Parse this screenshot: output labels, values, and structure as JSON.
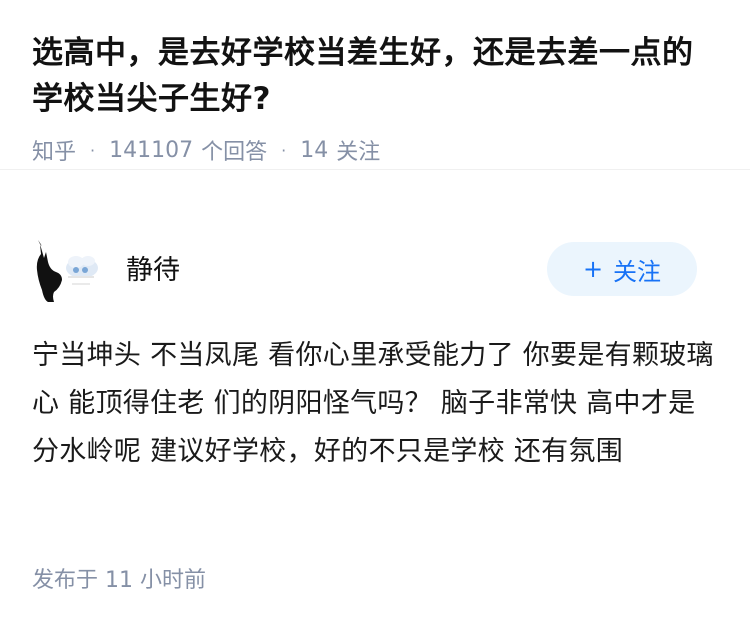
{
  "question": {
    "title": "选高中，是去好学校当差生好，还是去差一点的学校当尖子生好?",
    "source": "知乎",
    "answer_count": "141107",
    "answer_suffix": "个回答",
    "follower_count": "14",
    "follower_suffix": "关注",
    "separator": "·"
  },
  "author": {
    "name": "静待",
    "avatar_icon": "black-cat-avatar-icon",
    "follow_label": "关注",
    "follow_plus": "+"
  },
  "answer": {
    "text": "宁当坤头 不当凤尾 看你心里承受能力了 你要是有颗玻璃心 能顶得住老 们的阴阳怪气吗？ 脑子非常快 高中才是分水岭呢 建议好学校，好的不只是学校 还有氛围",
    "published": "发布于 11 小时前"
  },
  "colors": {
    "accent": "#1772f6",
    "button_bg": "#ebf5fd",
    "meta": "#8590a6",
    "text": "#121212"
  }
}
